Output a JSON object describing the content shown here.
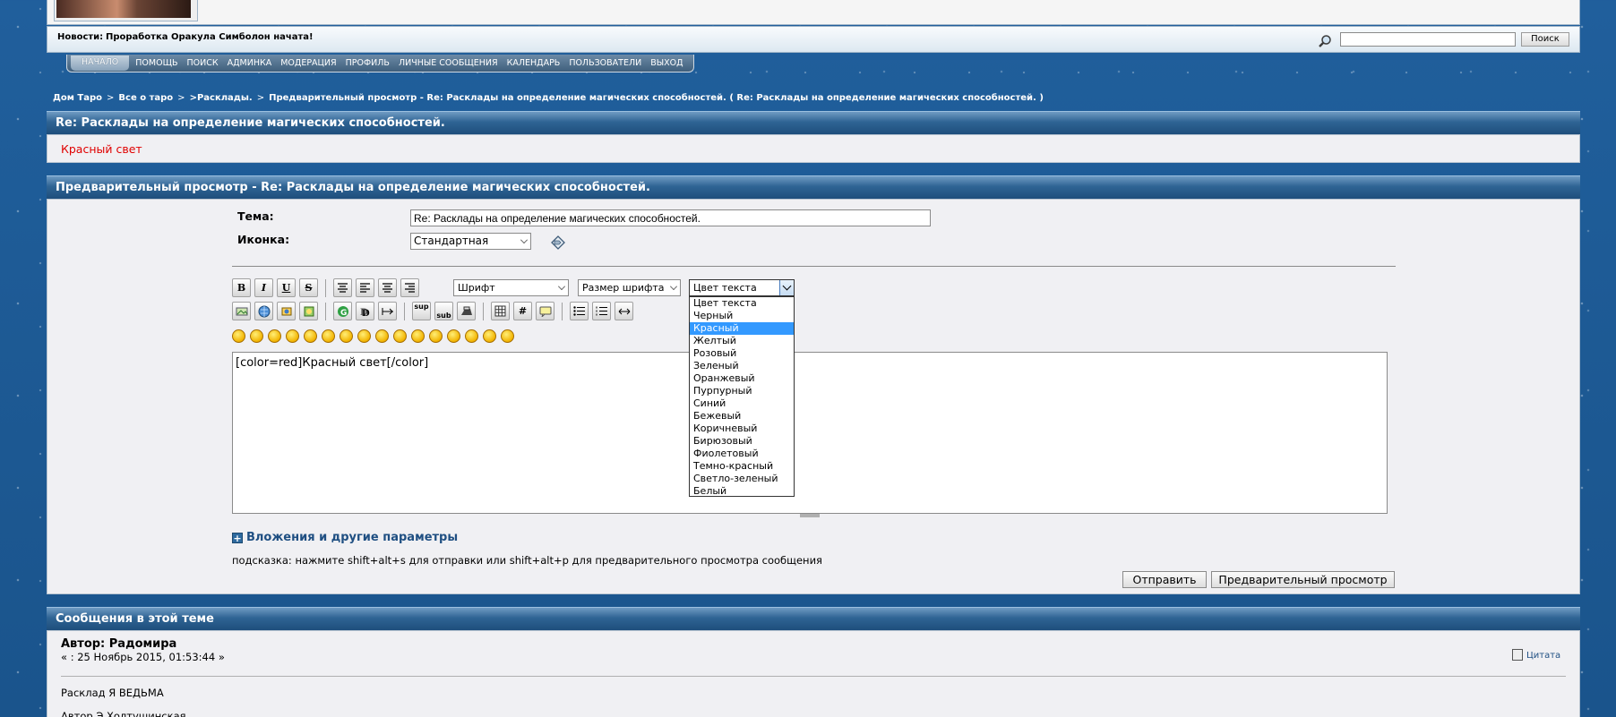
{
  "news": {
    "label": "Новости:",
    "text": "Проработка Оракула Симболон начата!"
  },
  "search": {
    "value": "",
    "button": "Поиск"
  },
  "nav": [
    "НАЧАЛО",
    "ПОМОЩЬ",
    "ПОИСК",
    "АДМИНКА",
    "МОДЕРАЦИЯ",
    "ПРОФИЛЬ",
    "ЛИЧНЫЕ СООБЩЕНИЯ",
    "КАЛЕНДАРЬ",
    "ПОЛЬЗОВАТЕЛИ",
    "ВЫХОД"
  ],
  "breadcrumb": [
    "Дом Таро",
    "Все о таро",
    ">Расклады.",
    "Предварительный просмотр - Re: Расклады на определение магических способностей. ( Re: Расклады на определение магических способностей. )"
  ],
  "post_title_bar": "Re: Расклады на определение магических способностей.",
  "preview_text": "Красный свет",
  "preview_color": "#e00000",
  "form_bar": "Предварительный просмотр - Re: Расклады на определение магических способностей.",
  "form": {
    "subject_label": "Тема:",
    "subject_value": "Re: Расклады на определение магических способностей.",
    "icon_label": "Иконка:",
    "icon_value": "Стандартная"
  },
  "toolbar": {
    "font": "Шрифт",
    "size": "Размер шрифта",
    "color": "Цвет текста",
    "sup": "sup",
    "sub": "sub"
  },
  "color_options": [
    "Цвет текста",
    "Черный",
    "Красный",
    "Желтый",
    "Розовый",
    "Зеленый",
    "Оранжевый",
    "Пурпурный",
    "Синий",
    "Бежевый",
    "Коричневый",
    "Бирюзовый",
    "Фиолетовый",
    "Темно-красный",
    "Светло-зеленый",
    "Белый"
  ],
  "color_selected": "Красный",
  "editor": {
    "text": "[color=red]Красный свет[/color]"
  },
  "attach_label": "Вложения и другие параметры",
  "hint": "подсказка: нажмите shift+alt+s для отправки или shift+alt+p для предварительного просмотра сообщения",
  "buttons": {
    "send": "Отправить",
    "preview": "Предварительный просмотр"
  },
  "thread": {
    "bar": "Сообщения в этой теме",
    "author": "Автор: Радомира",
    "date": "« : 25 Ноябрь 2015, 01:53:44 »",
    "quote": "Цитата",
    "body1": "Расклад Я ВЕДЬМА",
    "body2": "Автор Э.Холтушинская"
  }
}
